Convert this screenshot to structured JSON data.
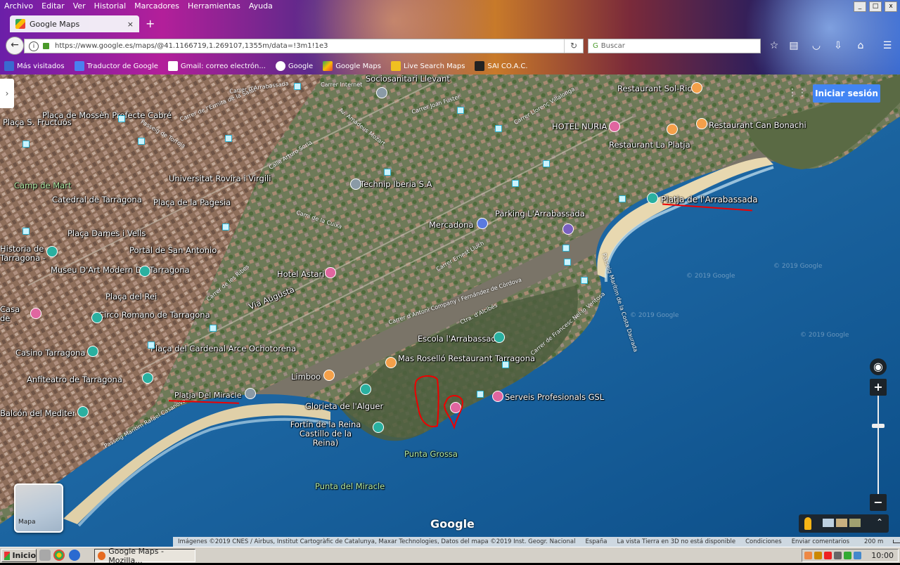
{
  "menu": [
    "Archivo",
    "Editar",
    "Ver",
    "Historial",
    "Marcadores",
    "Herramientas",
    "Ayuda"
  ],
  "tab": {
    "title": "Google Maps",
    "close": "×",
    "new": "+"
  },
  "nav": {
    "url": "https://www.google.es/maps/@41.1166719,1.269107,1355m/data=!3m1!1e3",
    "search_placeholder": "Buscar",
    "back": "←",
    "reload": "↻"
  },
  "bookmarks": [
    "Más visitados",
    "Traductor de Google",
    "Gmail: correo electrón...",
    "Google",
    "Google Maps",
    "Live Search Maps",
    "SAI CO.A.C."
  ],
  "map": {
    "signin": "Iniciar sesión",
    "logo": "Google",
    "minimap_label": "Mapa",
    "places": [
      "Sociosanitari Llevant",
      "Restaurant Sol-Ric",
      "HOTEL NURIA",
      "Restaurant Can Bonachi",
      "Restaurant La Platja",
      "Plaça de Mossèn Prefecte Cabré",
      "Plaça S. Fructuós",
      "Universitat Rovira i Virgili",
      "Camp de Mart",
      "Catedral de Tarragona",
      "Plaça de la Pagesia",
      "Plaça Dames i Vells",
      "Portal de San Antonio",
      "Historia de Tarragona - Casa...",
      "Museu D'Art Modern De Tarragona",
      "Plaça del Rei",
      "Circo Romano de Tarragona",
      "Casa de Sant Ramon - La Tecla",
      "Casino Tarragona",
      "Plaça del Cardenal Arce Ochotorena",
      "Anfiteatro de Tarragona",
      "Balcón del Mediterráneo",
      "Technip Iberia S.A",
      "Mercadona",
      "Parking L'Arrabassada",
      "Platja de l'Arrabassada",
      "Hotel Astari",
      "Via Augusta",
      "Escola l'Arrabassada",
      "Mas Roselló Restaurant Tarragona",
      "Limboo",
      "Platja Del Miracle",
      "Glorieta de l'Alguer",
      "Fortín de la Reina Castillo de la Reina)",
      "Serveis Profesionals GSL",
      "Punta Grossa",
      "Punta del Miracle"
    ],
    "streets": [
      "Carrer de l'Ermita de la Salut",
      "Carrer d'Arrabassada",
      "Carrer Internet",
      "Carrer Joan Fuster",
      "Carrer Llorenç Villalonga",
      "Av. Amadeus Mozart",
      "Passeig de Torroja",
      "Calle Arturo Soria",
      "Camí de la Cuixa",
      "Carrer Ernest Lluch",
      "Carrer de les Ribes",
      "Carrer d'Antoni Company i Fernández de Còrdova",
      "Ctra. d'Alcibés",
      "Carrer de Francesc Nel·lo Ventosa",
      "Passeig Marítim Rafael Casanova",
      "Passeig Marítim de la Costa Daurada"
    ],
    "watermarks": [
      "© 2019 Google",
      "© 2019 Google",
      "© 2019 Google",
      "© 2019 Google"
    ]
  },
  "footer": [
    "Imágenes ©2019 CNES / Airbus, Institut Cartogràfic de Catalunya, Maxar Technologies, Datos del mapa ©2019 Inst. Geogr. Nacional",
    "España",
    "La vista Tierra en 3D no está disponible",
    "Condiciones",
    "Enviar comentarios",
    "200 m"
  ],
  "taskbar": {
    "start": "Inicio",
    "window": "Google Maps - Mozilla...",
    "clock": "10:00"
  },
  "colors": {
    "accent": "#4285f4",
    "annotation": "#e00000"
  }
}
